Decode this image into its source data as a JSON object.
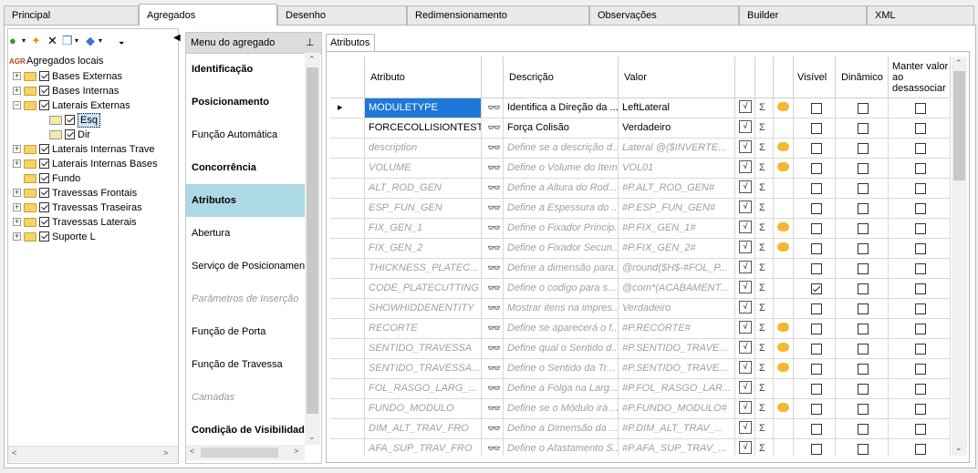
{
  "tabs": [
    {
      "label": "Principal",
      "active": false
    },
    {
      "label": "Agregados",
      "active": true
    },
    {
      "label": "Desenho",
      "active": false
    },
    {
      "label": "Redimensionamento",
      "active": false
    },
    {
      "label": "Observações",
      "active": false
    },
    {
      "label": "Builder",
      "active": false
    },
    {
      "label": "XML",
      "active": false
    }
  ],
  "tree": {
    "root_prefix": "AGR",
    "root_label": "Agregados locais",
    "items": [
      {
        "label": "Bases Externas",
        "checked": true,
        "level": 1,
        "expand": "+"
      },
      {
        "label": "Bases Internas",
        "checked": true,
        "level": 1,
        "expand": "+"
      },
      {
        "label": "Laterais Externas",
        "checked": true,
        "level": 1,
        "expand": "-"
      },
      {
        "label": "Esq",
        "checked": true,
        "level": 2,
        "expand": "",
        "selected": true
      },
      {
        "label": "Dir",
        "checked": true,
        "level": 2,
        "expand": ""
      },
      {
        "label": "Laterais Internas Trave",
        "checked": true,
        "level": 1,
        "expand": "+"
      },
      {
        "label": "Laterais Internas Bases",
        "checked": true,
        "level": 1,
        "expand": "+"
      },
      {
        "label": "Fundo",
        "checked": true,
        "level": 1,
        "expand": ""
      },
      {
        "label": "Travessas Frontais",
        "checked": true,
        "level": 1,
        "expand": "+"
      },
      {
        "label": "Travessas Traseiras",
        "checked": true,
        "level": 1,
        "expand": "+"
      },
      {
        "label": "Travessas Laterais",
        "checked": true,
        "level": 1,
        "expand": "+"
      },
      {
        "label": "Suporte L",
        "checked": true,
        "level": 1,
        "expand": "+"
      }
    ]
  },
  "menu": {
    "title": "Menu do agregado",
    "pin_icon": "pin-icon",
    "items": [
      {
        "label": "Identificação",
        "style": "bold"
      },
      {
        "label": "Posicionamento",
        "style": "bold"
      },
      {
        "label": "Função Automática",
        "style": "normal"
      },
      {
        "label": "Concorrência",
        "style": "bold"
      },
      {
        "label": "Atributos",
        "style": "bold-selected"
      },
      {
        "label": "Abertura",
        "style": "normal"
      },
      {
        "label": "Serviço de Posicionamen",
        "style": "normal"
      },
      {
        "label": "Parâmetros de Inserção",
        "style": "disabled"
      },
      {
        "label": "Função de Porta",
        "style": "normal"
      },
      {
        "label": "Função de Travessa",
        "style": "normal"
      },
      {
        "label": "Camadas",
        "style": "disabled"
      },
      {
        "label": "Condição de Visibilidade",
        "style": "bold"
      }
    ]
  },
  "attributes_tab": "Atributos",
  "grid": {
    "headers": {
      "attr": "Atributo",
      "desc": "Descrição",
      "valor": "Valor",
      "visivel": "Visível",
      "dinamico": "Dinâmico",
      "manter": "Manter valor ao desassociar"
    },
    "rows": [
      {
        "attr": "MODULETYPE",
        "desc": "Identifica a Direção da ...",
        "valor": "LeftLateral",
        "bubble": true,
        "visivel": false,
        "dinamico": false,
        "manter": false,
        "disabled": false,
        "selected": true
      },
      {
        "attr": "FORCECOLLISIONTEST",
        "desc": "Força Colisão",
        "valor": "Verdadeiro",
        "bubble": false,
        "visivel": false,
        "dinamico": false,
        "manter": false,
        "disabled": false,
        "selected": false
      },
      {
        "attr": "description",
        "desc": "Define se a descrição d...",
        "valor": "Lateral @($INVERTE...",
        "bubble": true,
        "visivel": false,
        "dinamico": false,
        "manter": false,
        "disabled": true
      },
      {
        "attr": "VOLUME",
        "desc": "Define o Volume do Item",
        "valor": "VOL01",
        "bubble": true,
        "visivel": false,
        "dinamico": false,
        "manter": false,
        "disabled": true
      },
      {
        "attr": "ALT_ROD_GEN",
        "desc": "Define a Altura do Rod...",
        "valor": "#P.ALT_ROD_GEN#",
        "bubble": false,
        "visivel": false,
        "dinamico": false,
        "manter": false,
        "disabled": true
      },
      {
        "attr": "ESP_FUN_GEN",
        "desc": "Define a Espessura do ...",
        "valor": "#P.ESP_FUN_GEN#",
        "bubble": false,
        "visivel": false,
        "dinamico": false,
        "manter": false,
        "disabled": true
      },
      {
        "attr": "FIX_GEN_1",
        "desc": "Define o Fixador Princip...",
        "valor": "#P.FIX_GEN_1#",
        "bubble": true,
        "visivel": false,
        "dinamico": false,
        "manter": false,
        "disabled": true
      },
      {
        "attr": "FIX_GEN_2",
        "desc": "Define o Fixador Secun...",
        "valor": "#P.FIX_GEN_2#",
        "bubble": true,
        "visivel": false,
        "dinamico": false,
        "manter": false,
        "disabled": true
      },
      {
        "attr": "THICKNESS_PLATEC...",
        "desc": "Define a dimensão para...",
        "valor": "@round($H$-#FOL_P...",
        "bubble": false,
        "visivel": false,
        "dinamico": false,
        "manter": false,
        "disabled": true
      },
      {
        "attr": "CODE_PLATECUTTING",
        "desc": "Define o codigo para s...",
        "valor": "@com*(ACABAMENT...",
        "bubble": false,
        "visivel": true,
        "dinamico": false,
        "manter": false,
        "disabled": true
      },
      {
        "attr": "SHOWHIDDENENTITY",
        "desc": "Mostrar itens na impres...",
        "valor": "Verdadeiro",
        "bubble": false,
        "visivel": false,
        "dinamico": false,
        "manter": false,
        "disabled": true
      },
      {
        "attr": "RECORTE",
        "desc": "Define se aparecerá o f...",
        "valor": "#P.RECORTE#",
        "bubble": true,
        "visivel": false,
        "dinamico": false,
        "manter": false,
        "disabled": true
      },
      {
        "attr": "SENTIDO_TRAVESSA",
        "desc": "Define qual o Sentido d...",
        "valor": "#P.SENTIDO_TRAVE...",
        "bubble": true,
        "visivel": false,
        "dinamico": false,
        "manter": false,
        "disabled": true
      },
      {
        "attr": "SENTIDO_TRAVESSA...",
        "desc": "Define o Sentido da Tr...",
        "valor": "#P.SENTIDO_TRAVE...",
        "bubble": true,
        "visivel": false,
        "dinamico": false,
        "manter": false,
        "disabled": true
      },
      {
        "attr": "FOL_RASGO_LARG_...",
        "desc": "Define a Folga na Larg...",
        "valor": "#P.FOL_RASGO_LAR...",
        "bubble": false,
        "visivel": false,
        "dinamico": false,
        "manter": false,
        "disabled": true
      },
      {
        "attr": "FUNDO_MODULO",
        "desc": "Define se o Módulo irá ...",
        "valor": "#P.FUNDO_MODULO#",
        "bubble": true,
        "visivel": false,
        "dinamico": false,
        "manter": false,
        "disabled": true
      },
      {
        "attr": "DIM_ALT_TRAV_FRO",
        "desc": "Define a Dimensão da ...",
        "valor": "#P.DIM_ALT_TRAV_...",
        "bubble": false,
        "visivel": false,
        "dinamico": false,
        "manter": false,
        "disabled": true
      },
      {
        "attr": "AFA_SUP_TRAV_FRO",
        "desc": "Define o Afastamento S...",
        "valor": "#P.AFA_SUP_TRAV_...",
        "bubble": false,
        "visivel": false,
        "dinamico": false,
        "manter": false,
        "disabled": true
      }
    ]
  },
  "colors": {
    "selection": "#1e78d7",
    "menu_selected": "#add8e6",
    "folder": "#f4d36b",
    "bubble": "#f5b731"
  }
}
